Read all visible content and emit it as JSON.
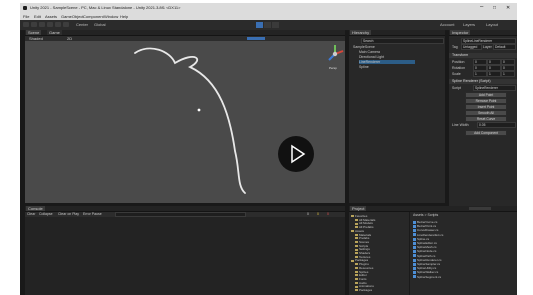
{
  "titlebar": {
    "title": "Unity 2021 - SampleScene - PC, Mac & Linux Standalone - Unity 2021.3.8f1 <DX11>",
    "minimize_icon": "minimize-icon",
    "maximize_icon": "maximize-icon",
    "close_icon": "close-icon"
  },
  "menubar": {
    "items": [
      "File",
      "Edit",
      "Assets",
      "GameObject",
      "Component",
      "Window",
      "Help"
    ]
  },
  "toolbar": {
    "tools": [
      "hand-tool-icon",
      "move-tool-icon",
      "rotate-tool-icon",
      "scale-tool-icon",
      "rect-tool-icon",
      "transform-tool-icon"
    ],
    "pivot_label": "Center",
    "space_label": "Global",
    "play_icon": "play-icon",
    "pause_icon": "pause-icon",
    "step_icon": "step-icon",
    "account_label": "Account",
    "layers_label": "Layers",
    "layout_label": "Layout"
  },
  "scene": {
    "tab_label": "Scene",
    "game_tab_label": "Game",
    "shading_label": "Shaded",
    "mode_label": "2D",
    "gizmo_label": "Persp",
    "play_overlay_icon": "play-icon"
  },
  "hierarchy": {
    "tab_label": "Hierarchy",
    "search_placeholder": "Search",
    "items": [
      "SampleScene",
      "Main Camera",
      "Directional Light",
      "LineRenderer",
      "Spline"
    ]
  },
  "inspector": {
    "tab_label": "Inspector",
    "object_name": "SplineLineRenderer",
    "tag_label": "Tag",
    "tag_value": "Untagged",
    "layer_label": "Layer",
    "layer_value": "Default",
    "transform_header": "Transform",
    "position_label": "Position",
    "rotation_label": "Rotation",
    "scale_label": "Scale",
    "position": {
      "x": "0",
      "y": "0",
      "z": "0"
    },
    "rotation": {
      "x": "0",
      "y": "0",
      "z": "0"
    },
    "scale": {
      "x": "1",
      "y": "1",
      "z": "1"
    },
    "script_header": "Spline Renderer (Script)",
    "script_label": "Script",
    "script_value": "SplineRenderer",
    "buttons": [
      "Add Point",
      "Remove Point",
      "Insert Point",
      "Smooth All",
      "Reset Curve"
    ],
    "line_label": "Line Width",
    "line_value": "0.05",
    "add_component": "Add Component"
  },
  "console": {
    "tab_label": "Console",
    "clear_label": "Clear",
    "collapse_label": "Collapse",
    "clear_on_play": "Clear on Play",
    "error_pause": "Error Pause",
    "search_placeholder": "",
    "counts": [
      "0",
      "0",
      "0"
    ]
  },
  "project": {
    "tab_label": "Project",
    "favorites_label": "Favorites",
    "tree": [
      "Favorites",
      "All Materials",
      "All Models",
      "All Prefabs",
      "Assets",
      "Materials",
      "Prefabs",
      "Scenes",
      "Scripts",
      "Settings",
      "Shaders",
      "Textures",
      "Packages",
      "Plugins",
      "Resources",
      "Sprites",
      "Editor",
      "Fonts",
      "Audio",
      "Animations",
      "Packages"
    ],
    "breadcrumb": "Assets > Scripts",
    "files": [
      "BezierCurve.cs",
      "BezierPoint.cs",
      "CurveDrawer.cs",
      "LineRendererExt.cs",
      "Spline.cs",
      "SplineEditor.cs",
      "SplineMesh.cs",
      "SplineNode.cs",
      "SplinePath.cs",
      "SplineRenderer.cs",
      "SplineSampler.cs",
      "SplineUtility.cs",
      "SplineWalker.cs",
      "SplineSegment.cs"
    ]
  },
  "colors": {
    "accent": "#3a6fb3",
    "scene_bg": "#4a4a4a",
    "panel_bg": "#282828",
    "curve": "#e8e8e8"
  }
}
